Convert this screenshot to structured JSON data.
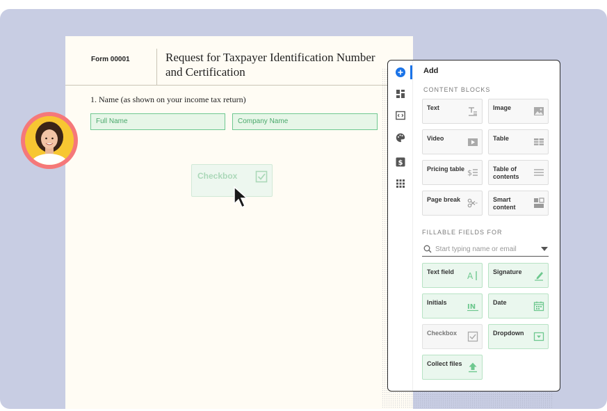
{
  "document": {
    "form_number": "Form 00001",
    "title": "Request for Taxpayer Identification Number and Certification",
    "name_label": "1. Name (as shown on your income tax return)",
    "fields": {
      "full_name": "Full Name",
      "company_name": "Company Name"
    },
    "drag_ghost_label": "Checkbox"
  },
  "panel": {
    "title": "Add",
    "content_blocks_heading": "CONTENT BLOCKS",
    "content_blocks": [
      {
        "label": "Text",
        "icon": "text-icon"
      },
      {
        "label": "Image",
        "icon": "image-icon"
      },
      {
        "label": "Video",
        "icon": "video-icon"
      },
      {
        "label": "Table",
        "icon": "table-icon"
      },
      {
        "label": "Pricing table",
        "icon": "pricing-table-icon"
      },
      {
        "label": "Table of contents",
        "icon": "toc-icon"
      },
      {
        "label": "Page break",
        "icon": "scissors-icon"
      },
      {
        "label": "Smart content",
        "icon": "smart-content-icon"
      }
    ],
    "fillable_heading": "FILLABLE FIELDS FOR",
    "search_placeholder": "Start typing name or email",
    "fillable_fields": [
      {
        "label": "Text field",
        "icon": "text-field-icon"
      },
      {
        "label": "Signature",
        "icon": "signature-icon"
      },
      {
        "label": "Initials",
        "icon": "initials-icon"
      },
      {
        "label": "Date",
        "icon": "calendar-icon"
      },
      {
        "label": "Checkbox",
        "icon": "checkbox-icon"
      },
      {
        "label": "Dropdown",
        "icon": "dropdown-icon"
      },
      {
        "label": "Collect files",
        "icon": "upload-icon"
      }
    ],
    "rail_icons": [
      "add-icon",
      "blocks-icon",
      "embed-icon",
      "palette-icon",
      "dollar-icon",
      "grid-icon"
    ]
  },
  "colors": {
    "accent_blue": "#1a73e8",
    "field_green": "#6ec88f",
    "stage_bg": "#c8cde3"
  }
}
